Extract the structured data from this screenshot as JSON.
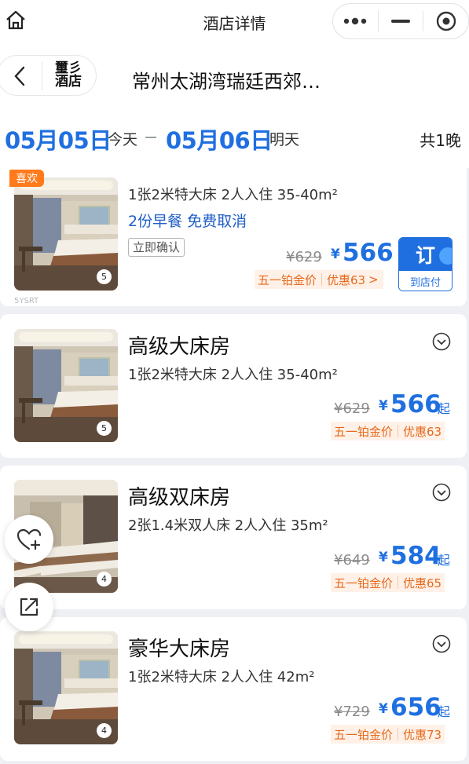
{
  "topbar": {
    "title": "酒店详情"
  },
  "hotel": {
    "logo_line1": "璽彡",
    "logo_line2": "酒店",
    "name": "常州太湖湾瑞廷西郊…"
  },
  "dates": {
    "checkin": "05月05日",
    "checkin_label": "今天",
    "checkout": "05月06日",
    "checkout_label": "明天",
    "nights": "共1晚"
  },
  "rooms": [
    {
      "name": "",
      "spec": "1张2米特大床 2人入住 35-40m²",
      "tag_like": "喜欢",
      "benefits": "2份早餐 免费取消",
      "confirm": "立即确认",
      "photo_count": "5",
      "orig_price": "¥629",
      "currency": "¥",
      "price": "566",
      "promo_label": "五一铂金价",
      "promo_discount": "优惠63",
      "promo_arrow": ">",
      "book_label": "订",
      "book_sub": "到店付",
      "watermark": "5YSRT"
    },
    {
      "name": "高级大床房",
      "spec": "1张2米特大床 2人入住 35-40m²",
      "photo_count": "5",
      "orig_price": "¥629",
      "currency": "¥",
      "price": "566",
      "suffix": "起",
      "promo_label": "五一铂金价",
      "promo_discount": "优惠63"
    },
    {
      "name": "高级双床房",
      "spec": "2张1.4米双人床 2人入住 35m²",
      "photo_count": "4",
      "orig_price": "¥649",
      "currency": "¥",
      "price": "584",
      "suffix": "起",
      "promo_label": "五一铂金价",
      "promo_discount": "优惠65"
    },
    {
      "name": "豪华大床房",
      "spec": "1张2米特大床 2人入住 42m²",
      "photo_count": "4",
      "orig_price": "¥729",
      "currency": "¥",
      "price": "656",
      "suffix": "起",
      "promo_label": "五一铂金价",
      "promo_discount": "优惠73"
    }
  ],
  "icons": {
    "home": "home-icon",
    "more": "more-dots-icon",
    "minimize": "minimize-icon",
    "close": "target-close-icon",
    "back": "back-chevron-icon",
    "expand": "chevron-circle-down-icon",
    "favorite": "heart-plus-icon",
    "share": "share-icon"
  },
  "colors": {
    "accent": "#1f6fe0",
    "promo": "#e66a1c",
    "like_tag": "#ff7a1a"
  }
}
